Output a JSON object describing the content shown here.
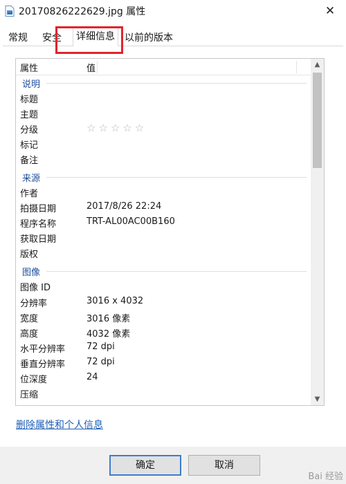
{
  "window": {
    "title": "20170826222629.jpg 属性"
  },
  "tabs": [
    {
      "label": "常规"
    },
    {
      "label": "安全"
    },
    {
      "label": "详细信息"
    },
    {
      "label": "以前的版本"
    }
  ],
  "columns": {
    "property": "属性",
    "value": "值"
  },
  "groups": {
    "description": "说明",
    "origin": "来源",
    "image": "图像"
  },
  "description_rows": [
    {
      "k": "标题",
      "v": ""
    },
    {
      "k": "主题",
      "v": ""
    },
    {
      "k": "分级",
      "v": ""
    },
    {
      "k": "标记",
      "v": ""
    },
    {
      "k": "备注",
      "v": ""
    }
  ],
  "rating": {
    "stars": "☆☆☆☆☆",
    "value": 0,
    "max": 5
  },
  "origin_rows": [
    {
      "k": "作者",
      "v": ""
    },
    {
      "k": "拍摄日期",
      "v": "2017/8/26 22:24"
    },
    {
      "k": "程序名称",
      "v": "TRT-AL00AC00B160"
    },
    {
      "k": "获取日期",
      "v": ""
    },
    {
      "k": "版权",
      "v": ""
    }
  ],
  "image_rows": [
    {
      "k": "图像 ID",
      "v": ""
    },
    {
      "k": "分辨率",
      "v": "3016 x 4032"
    },
    {
      "k": "宽度",
      "v": "3016 像素"
    },
    {
      "k": "高度",
      "v": "4032 像素"
    },
    {
      "k": "水平分辨率",
      "v": "72 dpi"
    },
    {
      "k": "垂直分辨率",
      "v": "72 dpi"
    },
    {
      "k": "位深度",
      "v": "24"
    },
    {
      "k": "压缩",
      "v": ""
    }
  ],
  "link": {
    "remove_props": "删除属性和个人信息"
  },
  "buttons": {
    "ok": "确定",
    "cancel": "取消"
  },
  "watermark": "Bai 经验",
  "colors": {
    "highlight": "#e0242f",
    "group": "#1f4e9c",
    "link": "#1d5fb5"
  }
}
